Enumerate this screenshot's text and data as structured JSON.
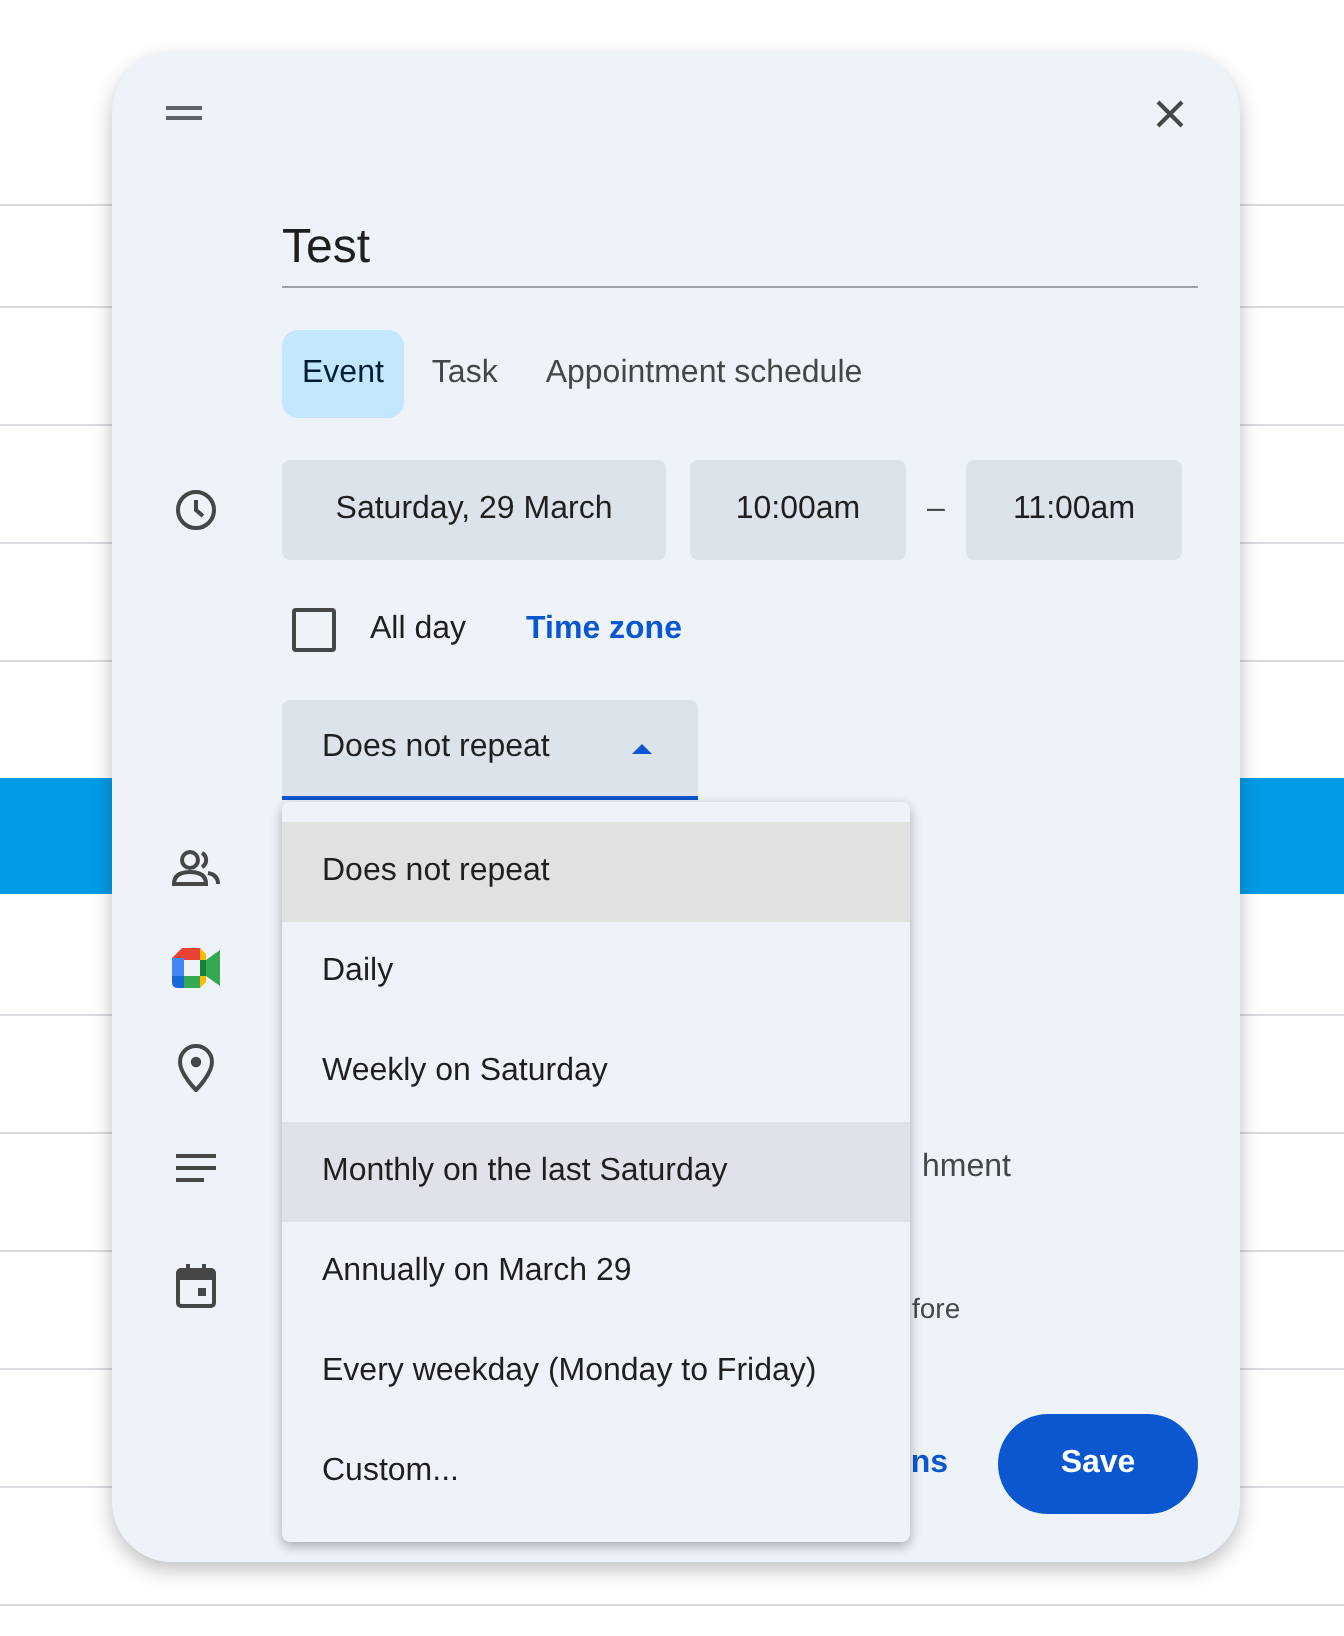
{
  "dialog": {
    "title_value": "Test",
    "event_types": [
      {
        "label": "Event",
        "selected": true
      },
      {
        "label": "Task",
        "selected": false
      },
      {
        "label": "Appointment schedule",
        "selected": false
      }
    ],
    "date": "Saturday, 29 March",
    "start_time": "10:00am",
    "separator": "–",
    "end_time": "11:00am",
    "all_day": {
      "label": "All day",
      "checked": false
    },
    "time_zone_link": "Time zone",
    "repeat": {
      "value": "Does not repeat",
      "expanded": true
    },
    "rows": [
      {
        "kind": "guests"
      },
      {
        "kind": "meet"
      },
      {
        "kind": "location"
      },
      {
        "kind": "description",
        "text": "hment"
      },
      {
        "kind": "calendar",
        "text": "fore"
      }
    ],
    "more_options_link": "ns",
    "save_button": "Save",
    "repeat_menu": [
      {
        "label": "Does not repeat",
        "selected": true,
        "hovered": false
      },
      {
        "label": "Daily",
        "selected": false,
        "hovered": false
      },
      {
        "label": "Weekly on Saturday",
        "selected": false,
        "hovered": false
      },
      {
        "label": "Monthly on the last Saturday",
        "selected": false,
        "hovered": true
      },
      {
        "label": "Annually on March 29",
        "selected": false,
        "hovered": false
      },
      {
        "label": "Every weekday (Monday to Friday)",
        "selected": false,
        "hovered": false
      },
      {
        "label": "Custom...",
        "selected": false,
        "hovered": false
      }
    ]
  }
}
